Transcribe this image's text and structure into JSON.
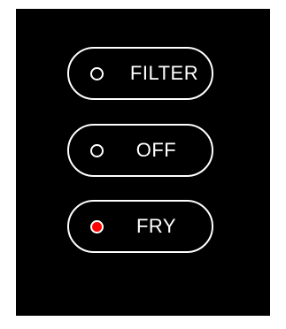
{
  "panel": {
    "background": "#000000",
    "buttons": [
      {
        "label": "FILTER",
        "indicator": "off",
        "indicator_color": "#000000"
      },
      {
        "label": "OFF",
        "indicator": "off",
        "indicator_color": "#000000"
      },
      {
        "label": "FRY",
        "indicator": "on",
        "indicator_color": "#ff0000"
      }
    ]
  }
}
